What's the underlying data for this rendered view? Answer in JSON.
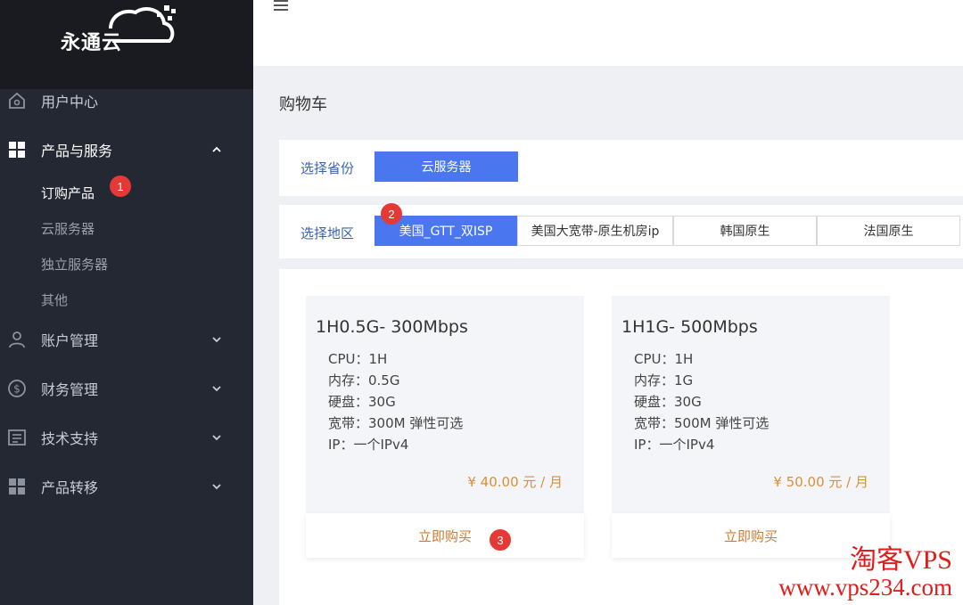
{
  "brand": {
    "name": "永通云"
  },
  "sidebar": {
    "items": [
      {
        "label": "用户中心",
        "icon": "home-icon"
      },
      {
        "label": "产品与服务",
        "icon": "grid-icon",
        "expanded": true,
        "children": [
          "订购产品",
          "云服务器",
          "独立服务器",
          "其他"
        ]
      },
      {
        "label": "账户管理",
        "icon": "user-icon"
      },
      {
        "label": "财务管理",
        "icon": "dollar-icon"
      },
      {
        "label": "技术支持",
        "icon": "ticket-icon"
      },
      {
        "label": "产品转移",
        "icon": "apps-icon"
      }
    ],
    "active_child": "订购产品"
  },
  "badges": {
    "b1": "1",
    "b2": "2",
    "b3": "3"
  },
  "page": {
    "title": "购物车"
  },
  "province": {
    "label": "选择省份",
    "options": [
      "云服务器"
    ],
    "selected": "云服务器"
  },
  "region": {
    "label": "选择地区",
    "tabs": [
      "美国_GTT_双ISP",
      "美国大宽带-原生机房ip",
      "韩国原生",
      "法国原生"
    ],
    "selected": "美国_GTT_双ISP"
  },
  "products": [
    {
      "name": "1H0.5G- 300Mbps",
      "specs": [
        "CPU：1H",
        "内存：0.5G",
        "硬盘：30G",
        "宽带：300M 弹性可选",
        "IP：一个IPv4"
      ],
      "price": "¥ 40.00 元 / 月",
      "buy": "立即购买"
    },
    {
      "name": "1H1G- 500Mbps",
      "specs": [
        "CPU：1H",
        "内存：1G",
        "硬盘：30G",
        "宽带：500M 弹性可选",
        "IP：一个IPv4"
      ],
      "price": "¥ 50.00 元 / 月",
      "buy": "立即购买"
    }
  ],
  "watermark": {
    "line1": "淘客VPS",
    "line2": "www.vps234.com"
  },
  "colors": {
    "accent": "#4a76f0",
    "sidebar": "#242833",
    "price": "#d98f3a",
    "badge": "#e53935"
  }
}
